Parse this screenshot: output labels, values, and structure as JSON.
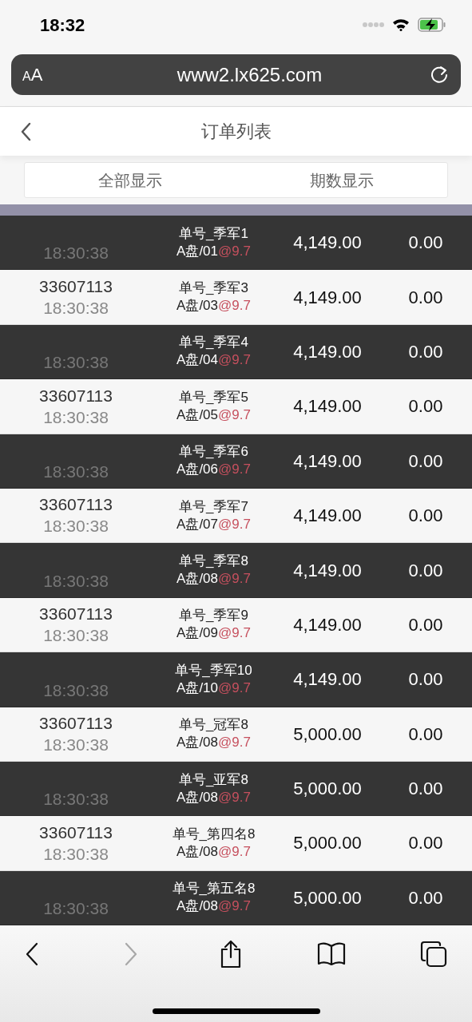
{
  "status_bar": {
    "time": "18:32"
  },
  "browser": {
    "text_size": "AA",
    "url": "www2.lx625.com"
  },
  "header": {
    "title": "订单列表"
  },
  "tabs": [
    {
      "label": "全部显示",
      "selected": false
    },
    {
      "label": "期数显示",
      "selected": false
    }
  ],
  "orders": [
    {
      "shaded": true,
      "time": "18:30:38",
      "bet": "单号_季军1",
      "line": "A盘/01",
      "odds": "@9.7",
      "amount": "4,149.00",
      "result": "0.00"
    },
    {
      "shaded": false,
      "order_no": "33607113",
      "time": "18:30:38",
      "bet": "单号_季军3",
      "line": "A盘/03",
      "odds": "@9.7",
      "amount": "4,149.00",
      "result": "0.00"
    },
    {
      "shaded": true,
      "time": "18:30:38",
      "bet": "单号_季军4",
      "line": "A盘/04",
      "odds": "@9.7",
      "amount": "4,149.00",
      "result": "0.00"
    },
    {
      "shaded": false,
      "order_no": "33607113",
      "time": "18:30:38",
      "bet": "单号_季军5",
      "line": "A盘/05",
      "odds": "@9.7",
      "amount": "4,149.00",
      "result": "0.00"
    },
    {
      "shaded": true,
      "time": "18:30:38",
      "bet": "单号_季军6",
      "line": "A盘/06",
      "odds": "@9.7",
      "amount": "4,149.00",
      "result": "0.00"
    },
    {
      "shaded": false,
      "order_no": "33607113",
      "time": "18:30:38",
      "bet": "单号_季军7",
      "line": "A盘/07",
      "odds": "@9.7",
      "amount": "4,149.00",
      "result": "0.00"
    },
    {
      "shaded": true,
      "time": "18:30:38",
      "bet": "单号_季军8",
      "line": "A盘/08",
      "odds": "@9.7",
      "amount": "4,149.00",
      "result": "0.00"
    },
    {
      "shaded": false,
      "order_no": "33607113",
      "time": "18:30:38",
      "bet": "单号_季军9",
      "line": "A盘/09",
      "odds": "@9.7",
      "amount": "4,149.00",
      "result": "0.00"
    },
    {
      "shaded": true,
      "time": "18:30:38",
      "bet": "单号_季军10",
      "line": "A盘/10",
      "odds": "@9.7",
      "amount": "4,149.00",
      "result": "0.00"
    },
    {
      "shaded": false,
      "order_no": "33607113",
      "time": "18:30:38",
      "bet": "单号_冠军8",
      "line": "A盘/08",
      "odds": "@9.7",
      "amount": "5,000.00",
      "result": "0.00"
    },
    {
      "shaded": true,
      "time": "18:30:38",
      "bet": "单号_亚军8",
      "line": "A盘/08",
      "odds": "@9.7",
      "amount": "5,000.00",
      "result": "0.00"
    },
    {
      "shaded": false,
      "order_no": "33607113",
      "time": "18:30:38",
      "bet": "单号_第四名8",
      "line": "A盘/08",
      "odds": "@9.7",
      "amount": "5,000.00",
      "result": "0.00"
    },
    {
      "shaded": true,
      "time": "18:30:38",
      "bet": "单号_第五名8",
      "line": "A盘/08",
      "odds": "@9.7",
      "amount": "5,000.00",
      "result": "0.00"
    }
  ],
  "toolbar": [
    {
      "kind": "back",
      "disabled": false
    },
    {
      "kind": "forward",
      "disabled": true
    },
    {
      "kind": "share",
      "disabled": false
    },
    {
      "kind": "bookmarks",
      "disabled": false
    },
    {
      "kind": "tabs",
      "disabled": false
    }
  ]
}
